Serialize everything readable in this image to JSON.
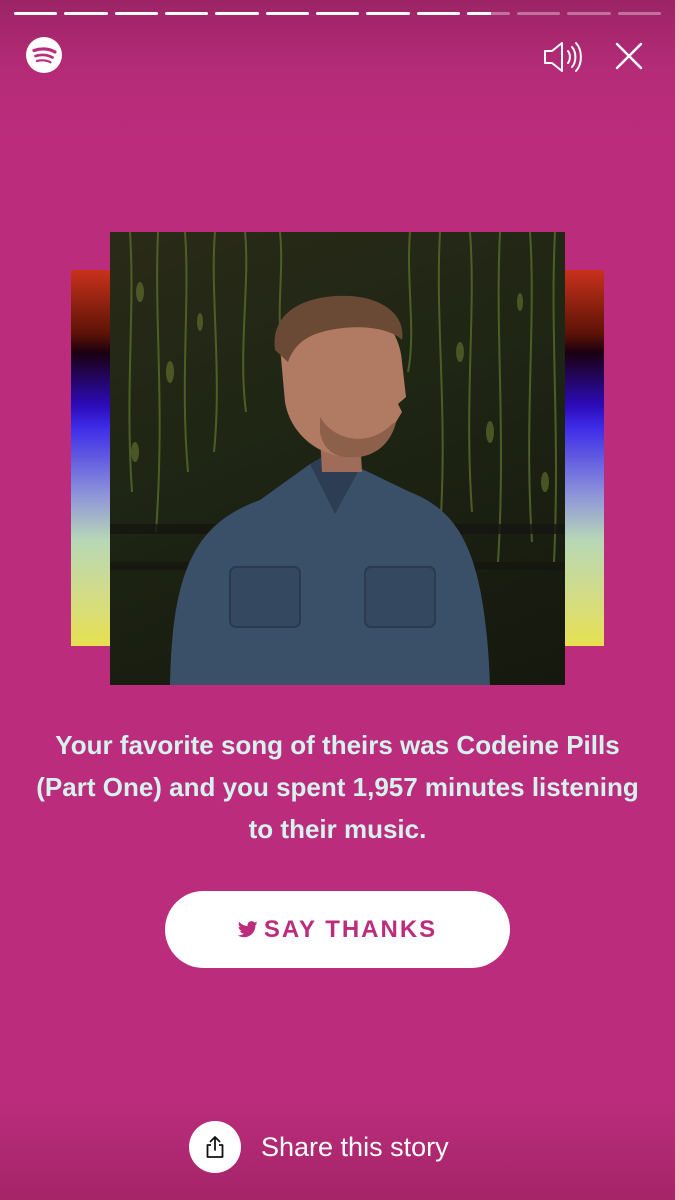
{
  "progress": {
    "segments": [
      1,
      1,
      1,
      1,
      1,
      1,
      1,
      1,
      1,
      0.55,
      0,
      0,
      0
    ]
  },
  "header": {
    "logo_icon": "spotify-logo",
    "volume_icon": "speaker-icon",
    "close_icon": "close-icon"
  },
  "artwork": {
    "bar_colors": [
      "#C8321C",
      "#5B1306",
      "#2C0BB8",
      "#8F95DA",
      "#B7D8B6",
      "#E7E050"
    ]
  },
  "caption": {
    "text": "Your favorite song of theirs was Codeine Pills (Part One) and you spent 1,957 minutes listening to their music."
  },
  "cta": {
    "label": "SAY THANKS",
    "icon": "twitter-bird-icon"
  },
  "share": {
    "label": "Share this story",
    "icon": "share-icon"
  },
  "colors": {
    "background": "#BB2D7C",
    "caption": "#D6F2EE",
    "accent": "#BB2D7C"
  }
}
